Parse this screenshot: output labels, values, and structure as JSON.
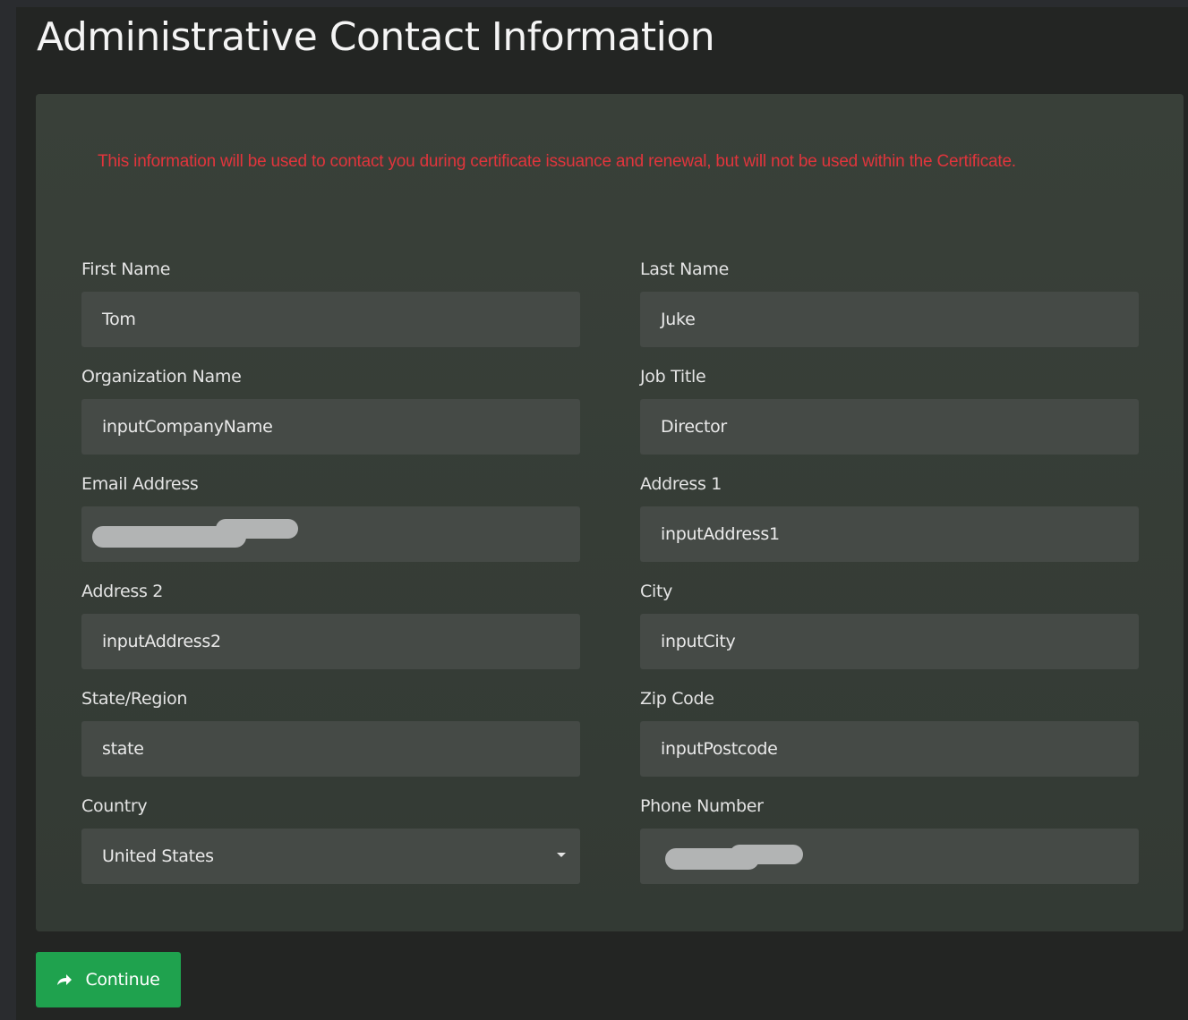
{
  "page": {
    "title": "Administrative Contact Information"
  },
  "notice": {
    "text": "This information will be used to contact you during certificate issuance and renewal, but will not be used within the Certificate.",
    "color": "#e0353c"
  },
  "form": {
    "first_name": {
      "label": "First Name",
      "value": "Tom"
    },
    "last_name": {
      "label": "Last Name",
      "value": "Juke"
    },
    "organization_name": {
      "label": "Organization Name",
      "value": "inputCompanyName"
    },
    "job_title": {
      "label": "Job Title",
      "value": "Director"
    },
    "email_address": {
      "label": "Email Address",
      "value": "",
      "redacted": true
    },
    "address1": {
      "label": "Address 1",
      "value": "inputAddress1"
    },
    "address2": {
      "label": "Address 2",
      "value": "inputAddress2"
    },
    "city": {
      "label": "City",
      "value": "inputCity"
    },
    "state_region": {
      "label": "State/Region",
      "value": "state"
    },
    "zip_code": {
      "label": "Zip Code",
      "value": "inputPostcode"
    },
    "country": {
      "label": "Country",
      "value": "United States",
      "icon": "chevron-down-icon"
    },
    "phone_number": {
      "label": "Phone Number",
      "value": "",
      "redacted": true
    }
  },
  "actions": {
    "continue_label": "Continue",
    "continue_icon": "arrow-right-icon",
    "continue_color": "#1fa24e"
  }
}
